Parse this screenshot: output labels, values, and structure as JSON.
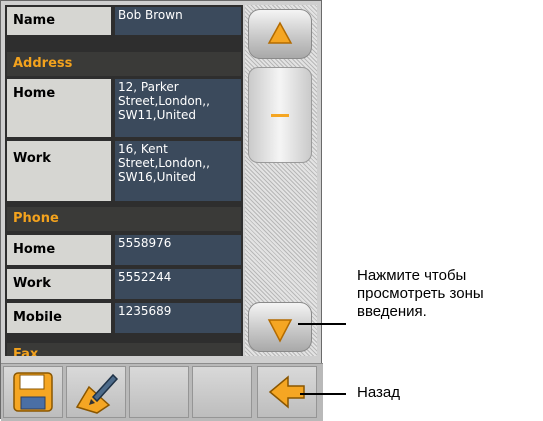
{
  "contact": {
    "name_label": "Name",
    "name_value": "Bob Brown",
    "address_header": "Address",
    "address_home_label": "Home",
    "address_home_value": "12, Parker Street,London,, SW11,United",
    "address_work_label": "Work",
    "address_work_value": "16, Kent Street,London,, SW16,United",
    "phone_header": "Phone",
    "phone_home_label": "Home",
    "phone_home_value": "5558976",
    "phone_work_label": "Work",
    "phone_work_value": "5552244",
    "phone_mobile_label": "Mobile",
    "phone_mobile_value": "1235689",
    "fax_header": "Fax"
  },
  "colors": {
    "section_text": "#f3a21d",
    "value_bg": "#3b4a5c",
    "label_bg": "#d6d6d2",
    "arrow_orange": "#f5a623"
  },
  "icons": {
    "scroll_up": "triangle-up-icon",
    "scroll_down": "triangle-down-icon",
    "save": "floppy-disk-icon",
    "edit": "edit-pencil-icon",
    "back": "left-arrow-icon"
  },
  "callouts": {
    "scroll_hint": "Нажмите чтобы просмотреть зоны введения.",
    "back_hint": "Назад"
  }
}
